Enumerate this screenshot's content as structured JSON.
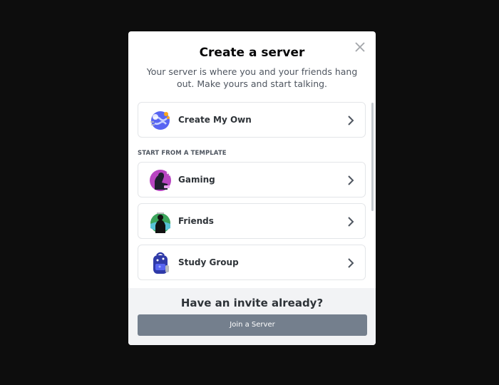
{
  "modal": {
    "title": "Create a server",
    "subtitle": "Your server is where you and your friends hang out. Make yours and start talking.",
    "create_own_label": "Create My Own",
    "template_header": "START FROM A TEMPLATE",
    "templates": [
      {
        "label": "Gaming",
        "icon": "gaming-icon"
      },
      {
        "label": "Friends",
        "icon": "friends-icon"
      },
      {
        "label": "Study Group",
        "icon": "study-group-icon"
      }
    ],
    "footer": {
      "title": "Have an invite already?",
      "join_label": "Join a Server"
    }
  },
  "colors": {
    "backdrop": "#0d0d0d",
    "modal_bg": "#ffffff",
    "footer_bg": "#f2f3f5",
    "join_button": "#747f8d",
    "text_primary": "#060607",
    "text_secondary": "#4f5660"
  }
}
